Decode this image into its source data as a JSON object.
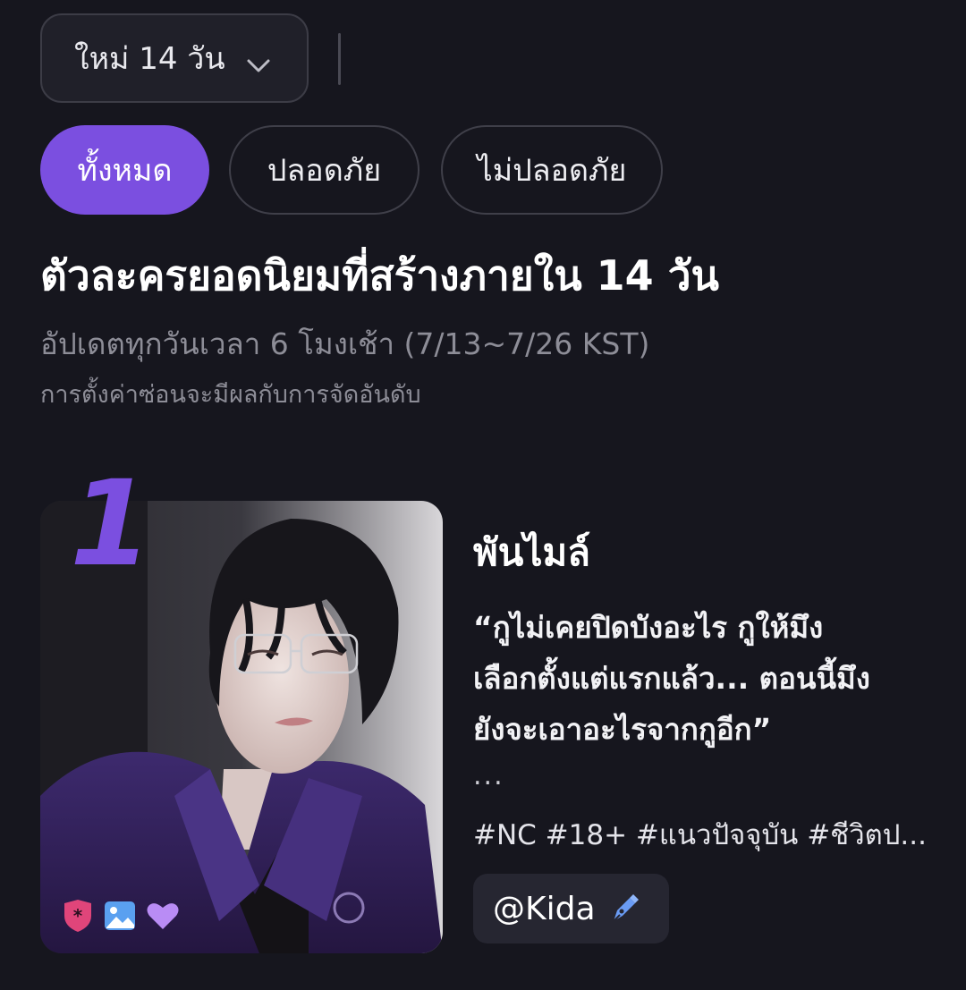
{
  "filter": {
    "period_label": "ใหม่ 14 วัน",
    "chips": [
      {
        "label": "ทั้งหมด",
        "active": true
      },
      {
        "label": "ปลอดภัย",
        "active": false
      },
      {
        "label": "ไม่ปลอดภัย",
        "active": false
      }
    ]
  },
  "section": {
    "title": "ตัวละครยอดนิยมที่สร้างภายใน 14 วัน",
    "update_note": "อัปเดตทุกวันเวลา 6 โมงเช้า (7/13~7/26 KST)",
    "hide_note": "การตั้งค่าซ่อนจะมีผลกับการจัดอันดับ"
  },
  "card": {
    "rank": "1",
    "name": "พันไมล์",
    "quote_lines": [
      "“กูไม่เคยปิดบังอะไร กูให้มึง",
      "เลือกตั้งแต่แรกแล้ว... ตอนนี้มึง",
      "ยังจะเอาอะไรจากกูอีก”"
    ],
    "ellipsis": "...",
    "tags": "#NC #18+ #แนวปัจจุบัน #ชีวิตป...",
    "creator": "@Kida",
    "badge_icons": [
      "adult-shield-icon",
      "image-icon",
      "heart-icon"
    ],
    "colors": {
      "accent": "#7b4fe0",
      "shield": "#e0457a",
      "image": "#5aa0f0",
      "heart": "#b98cf5"
    }
  }
}
